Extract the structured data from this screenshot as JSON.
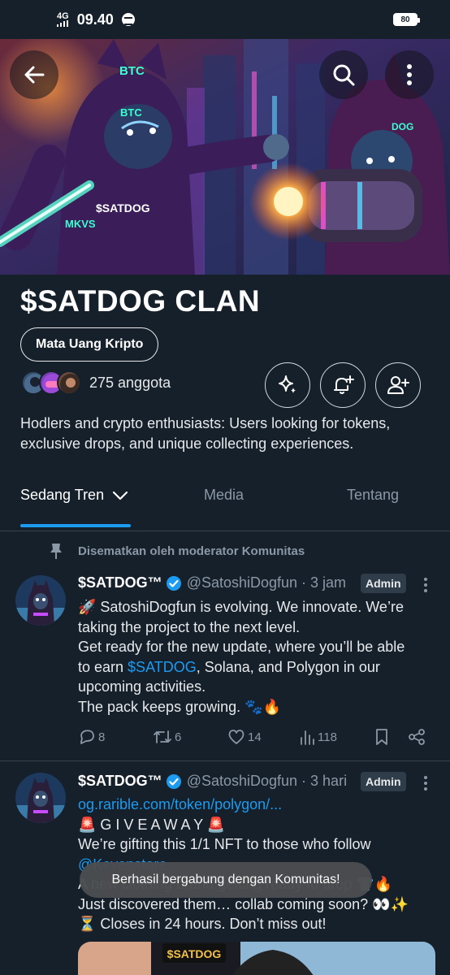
{
  "status_bar": {
    "network": "4G",
    "time": "09.40",
    "battery": "80"
  },
  "banner": {
    "left_character": {
      "ear_tag": "BTC",
      "hood_badge": "BTC",
      "shirt_text": "$SATDOG",
      "sleeve_tag": "MKVS"
    },
    "right_character": {
      "hood_badge": "DOG"
    }
  },
  "community": {
    "title": "$SATDOG CLAN",
    "category": "Mata Uang Kripto",
    "member_count": "275 anggota",
    "description": "Hodlers and crypto enthusiasts: Users looking for tokens, exclusive drops, and unique collecting experiences."
  },
  "tabs": [
    {
      "label": "Sedang Tren",
      "active": true
    },
    {
      "label": "Media",
      "active": false
    },
    {
      "label": "Tentang",
      "active": false
    }
  ],
  "pinned_label": "Disematkan oleh moderator Komunitas",
  "posts": [
    {
      "author": "$SATDOG™",
      "handle": "@SatoshiDogfun · 3 jam",
      "badge": "Admin",
      "line1": "🚀 SatoshiDogfun is evolving. We innovate. We’re",
      "line2": "taking the project to the next level.",
      "line3": "Get ready for the new update, where you’ll be able",
      "line4_pre": "to earn ",
      "line4_link": "$SATDOG",
      "line4_post": ", Solana, and Polygon in our",
      "line5": "upcoming activities.",
      "line6": "The pack keeps growing. 🐾🔥",
      "replies": "8",
      "reposts": "6",
      "likes": "14",
      "views": "118"
    },
    {
      "author": "$SATDOG™",
      "handle": "@SatoshiDogfun · 3 hari",
      "badge": "Admin",
      "link": "og.rarible.com/token/polygon/...",
      "line1": "🚨 G I V E A W A Y 🚨",
      "line2": "We’re gifting this 1/1 NFT to those who follow",
      "line3_link": "@Kevenstore",
      "line4": "A new clothing brand getting ready to drop 👕🔥",
      "line5": "Just discovered them… collab coming soon? 👀✨",
      "line6": "⏳ Closes in 24 hours. Don’t miss out!",
      "media_text": "$SATDOG"
    }
  ],
  "toast": "Berhasil bergabung dengan Komunitas!",
  "colors": {
    "background": "#15202b",
    "accent": "#1d9bf0",
    "muted": "#8b98a5",
    "border": "#38444d"
  }
}
